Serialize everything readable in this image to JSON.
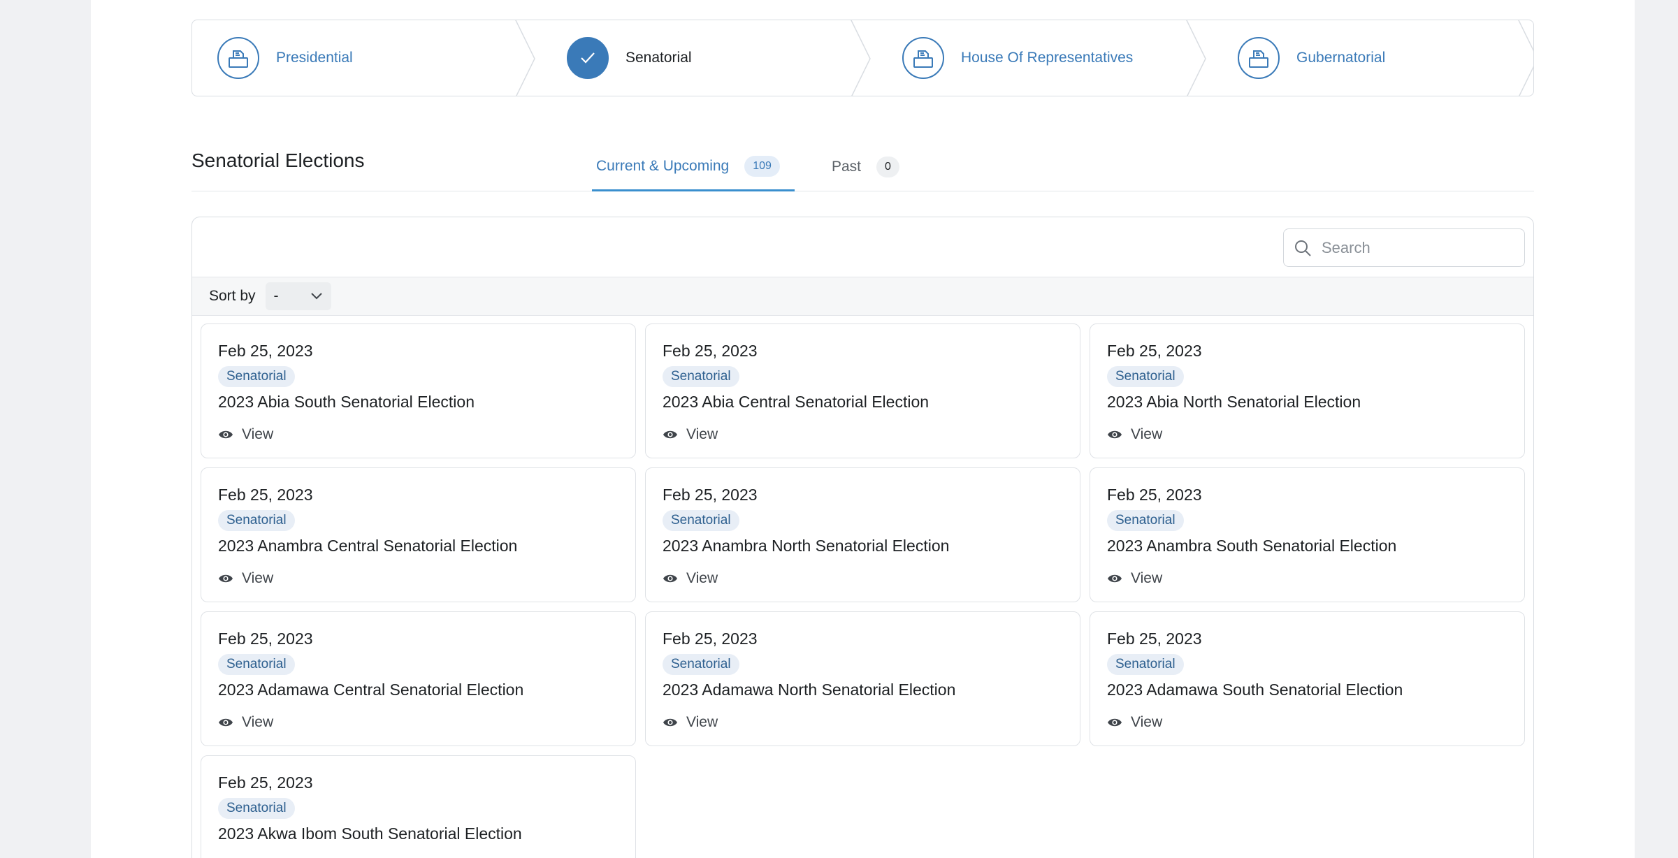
{
  "stepper": [
    {
      "label": "Presidential",
      "icon": "ballot-box-icon",
      "state": "link"
    },
    {
      "label": "Senatorial",
      "icon": "check-icon",
      "state": "active"
    },
    {
      "label": "House Of Representatives",
      "icon": "ballot-box-icon",
      "state": "link"
    },
    {
      "label": "Gubernatorial",
      "icon": "ballot-box-icon",
      "state": "link"
    }
  ],
  "section": {
    "title": "Senatorial Elections"
  },
  "tabs": [
    {
      "label": "Current & Upcoming",
      "count": "109",
      "active": true
    },
    {
      "label": "Past",
      "count": "0",
      "active": false
    }
  ],
  "search": {
    "placeholder": "Search"
  },
  "sort": {
    "label": "Sort by",
    "value": "-"
  },
  "view_label": "View",
  "elections": [
    {
      "date": "Feb 25, 2023",
      "tag": "Senatorial",
      "title": "2023 Abia South Senatorial Election"
    },
    {
      "date": "Feb 25, 2023",
      "tag": "Senatorial",
      "title": "2023 Abia Central Senatorial Election"
    },
    {
      "date": "Feb 25, 2023",
      "tag": "Senatorial",
      "title": "2023 Abia North Senatorial Election"
    },
    {
      "date": "Feb 25, 2023",
      "tag": "Senatorial",
      "title": "2023 Anambra Central Senatorial Election"
    },
    {
      "date": "Feb 25, 2023",
      "tag": "Senatorial",
      "title": "2023 Anambra North Senatorial Election"
    },
    {
      "date": "Feb 25, 2023",
      "tag": "Senatorial",
      "title": "2023 Anambra South Senatorial Election"
    },
    {
      "date": "Feb 25, 2023",
      "tag": "Senatorial",
      "title": "2023 Adamawa Central Senatorial Election"
    },
    {
      "date": "Feb 25, 2023",
      "tag": "Senatorial",
      "title": "2023 Adamawa North Senatorial Election"
    },
    {
      "date": "Feb 25, 2023",
      "tag": "Senatorial",
      "title": "2023 Adamawa South Senatorial Election"
    },
    {
      "date": "Feb 25, 2023",
      "tag": "Senatorial",
      "title": "2023 Akwa Ibom South Senatorial Election"
    }
  ],
  "colors": {
    "accent": "#3a7ab8",
    "tab_underline": "#3a8fce",
    "tag_bg": "#e8eef6"
  }
}
